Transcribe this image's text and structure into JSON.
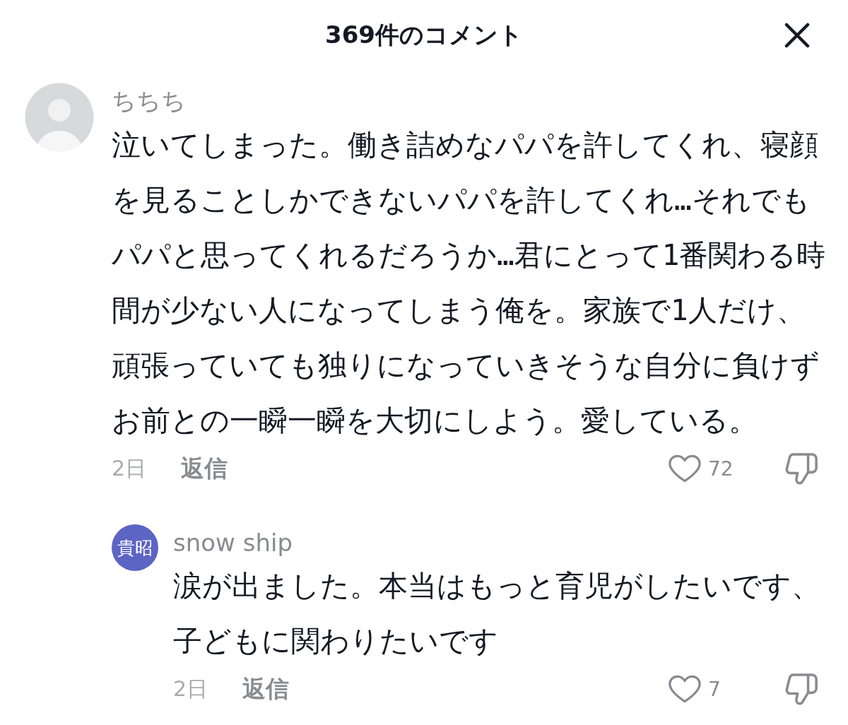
{
  "header": {
    "title": "369件のコメント"
  },
  "comments": [
    {
      "avatar": {
        "kind": "silhouette"
      },
      "username": "ちちち",
      "text": "泣いてしまった。働き詰めなパパを許してくれ、寝顔を見ることしかできないパパを許してくれ…それでもパパと思ってくれるだろうか…君にとって1番関わる時間が少ない人になってしまう俺を。家族で1人だけ、頑張っていても独りになっていきそうな自分に負けずお前との一瞬一瞬を大切にしよう。愛している。",
      "time": "2日",
      "reply_label": "返信",
      "liked": false,
      "likes": "72",
      "replies": [
        {
          "avatar": {
            "kind": "initials",
            "text": "貴昭"
          },
          "username": "snow ship",
          "text": "涙が出ました。本当はもっと育児がしたいです、子どもに関わりたいです",
          "time": "2日",
          "reply_label": "返信",
          "liked": false,
          "likes": "7"
        }
      ]
    }
  ]
}
